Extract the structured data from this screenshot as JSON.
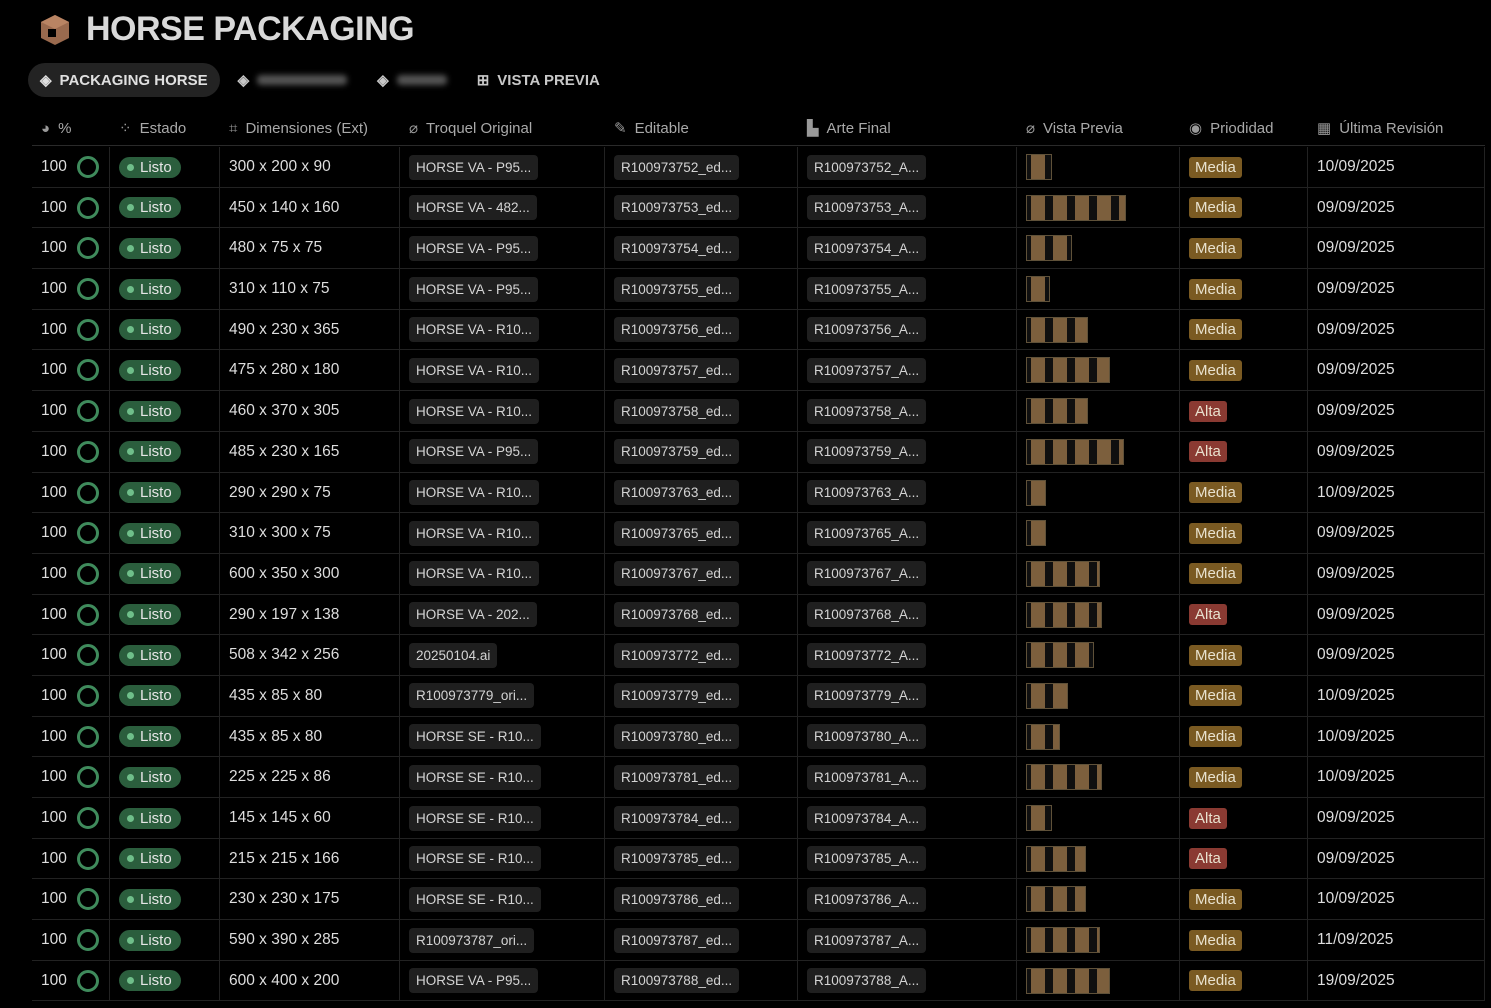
{
  "app": {
    "title": "HORSE PACKAGING",
    "brand_color": "#9a6a4e"
  },
  "tabs": [
    {
      "label": "PACKAGING HORSE",
      "icon": "cube-icon",
      "active": true
    },
    {
      "label": "",
      "icon": "cube-icon",
      "blurred": true
    },
    {
      "label": "",
      "icon": "cube-icon",
      "blurred": true
    },
    {
      "label": "VISTA PREVIA",
      "icon": "grid-icon"
    }
  ],
  "columns": [
    {
      "label": "%",
      "icon": "pie-icon"
    },
    {
      "label": "Estado",
      "icon": "loading-icon"
    },
    {
      "label": "Dimensiones (Ext)",
      "icon": "crop-icon"
    },
    {
      "label": "Troquel Original",
      "icon": "paperclip-icon"
    },
    {
      "label": "Editable",
      "icon": "pencil-icon"
    },
    {
      "label": "Arte Final",
      "icon": "printer-icon"
    },
    {
      "label": "Vista Previa",
      "icon": "paperclip-icon"
    },
    {
      "label": "Priodidad",
      "icon": "chevron-circle-icon"
    },
    {
      "label": "Última Revisión",
      "icon": "calendar-icon"
    }
  ],
  "colors": {
    "listo": "#2b5e3d",
    "media": "#7a5a22",
    "alta": "#8a3a32"
  },
  "rows": [
    {
      "pct": "100",
      "estado": "Listo",
      "dim": "300 x 200 x 90",
      "troquel": "HORSE VA - P95...",
      "editable": "R100973752_ed...",
      "arte": "R100973752_A...",
      "prio": "Media",
      "fecha": "10/09/2025"
    },
    {
      "pct": "100",
      "estado": "Listo",
      "dim": "450 x 140 x 160",
      "troquel": "HORSE VA - 482...",
      "editable": "R100973753_ed...",
      "arte": "R100973753_A...",
      "prio": "Media",
      "fecha": "09/09/2025"
    },
    {
      "pct": "100",
      "estado": "Listo",
      "dim": "480 x 75 x 75",
      "troquel": "HORSE VA - P95...",
      "editable": "R100973754_ed...",
      "arte": "R100973754_A...",
      "prio": "Media",
      "fecha": "09/09/2025"
    },
    {
      "pct": "100",
      "estado": "Listo",
      "dim": "310 x 110 x 75",
      "troquel": "HORSE VA - P95...",
      "editable": "R100973755_ed...",
      "arte": "R100973755_A...",
      "prio": "Media",
      "fecha": "09/09/2025"
    },
    {
      "pct": "100",
      "estado": "Listo",
      "dim": "490 x 230 x 365",
      "troquel": "HORSE VA - R10...",
      "editable": "R100973756_ed...",
      "arte": "R100973756_A...",
      "prio": "Media",
      "fecha": "09/09/2025"
    },
    {
      "pct": "100",
      "estado": "Listo",
      "dim": "475 x 280 x 180",
      "troquel": "HORSE VA - R10...",
      "editable": "R100973757_ed...",
      "arte": "R100973757_A...",
      "prio": "Media",
      "fecha": "09/09/2025"
    },
    {
      "pct": "100",
      "estado": "Listo",
      "dim": "460 x 370 x 305",
      "troquel": "HORSE VA - R10...",
      "editable": "R100973758_ed...",
      "arte": "R100973758_A...",
      "prio": "Alta",
      "fecha": "09/09/2025"
    },
    {
      "pct": "100",
      "estado": "Listo",
      "dim": "485 x 230 x 165",
      "troquel": "HORSE VA - P95...",
      "editable": "R100973759_ed...",
      "arte": "R100973759_A...",
      "prio": "Alta",
      "fecha": "09/09/2025"
    },
    {
      "pct": "100",
      "estado": "Listo",
      "dim": "290 x 290 x 75",
      "troquel": "HORSE VA - R10...",
      "editable": "R100973763_ed...",
      "arte": "R100973763_A...",
      "prio": "Media",
      "fecha": "10/09/2025"
    },
    {
      "pct": "100",
      "estado": "Listo",
      "dim": "310 x 300 x 75",
      "troquel": "HORSE VA - R10...",
      "editable": "R100973765_ed...",
      "arte": "R100973765_A...",
      "prio": "Media",
      "fecha": "09/09/2025"
    },
    {
      "pct": "100",
      "estado": "Listo",
      "dim": "600 x 350 x 300",
      "troquel": "HORSE VA - R10...",
      "editable": "R100973767_ed...",
      "arte": "R100973767_A...",
      "prio": "Media",
      "fecha": "09/09/2025"
    },
    {
      "pct": "100",
      "estado": "Listo",
      "dim": "290 x 197 x 138",
      "troquel": "HORSE VA - 202...",
      "editable": "R100973768_ed...",
      "arte": "R100973768_A...",
      "prio": "Alta",
      "fecha": "09/09/2025"
    },
    {
      "pct": "100",
      "estado": "Listo",
      "dim": "508 x 342 x 256",
      "troquel": "20250104.ai",
      "editable": "R100973772_ed...",
      "arte": "R100973772_A...",
      "prio": "Media",
      "fecha": "09/09/2025"
    },
    {
      "pct": "100",
      "estado": "Listo",
      "dim": "435 x 85 x 80",
      "troquel": "R100973779_ori...",
      "editable": "R100973779_ed...",
      "arte": "R100973779_A...",
      "prio": "Media",
      "fecha": "10/09/2025"
    },
    {
      "pct": "100",
      "estado": "Listo",
      "dim": "435 x 85 x 80",
      "troquel": "HORSE SE - R10...",
      "editable": "R100973780_ed...",
      "arte": "R100973780_A...",
      "prio": "Media",
      "fecha": "10/09/2025"
    },
    {
      "pct": "100",
      "estado": "Listo",
      "dim": "225 x 225 x 86",
      "troquel": "HORSE SE - R10...",
      "editable": "R100973781_ed...",
      "arte": "R100973781_A...",
      "prio": "Media",
      "fecha": "10/09/2025"
    },
    {
      "pct": "100",
      "estado": "Listo",
      "dim": "145 x 145 x 60",
      "troquel": "HORSE SE - R10...",
      "editable": "R100973784_ed...",
      "arte": "R100973784_A...",
      "prio": "Alta",
      "fecha": "09/09/2025"
    },
    {
      "pct": "100",
      "estado": "Listo",
      "dim": "215 x 215 x 166",
      "troquel": "HORSE SE - R10...",
      "editable": "R100973785_ed...",
      "arte": "R100973785_A...",
      "prio": "Alta",
      "fecha": "09/09/2025"
    },
    {
      "pct": "100",
      "estado": "Listo",
      "dim": "230 x 230 x 175",
      "troquel": "HORSE SE - R10...",
      "editable": "R100973786_ed...",
      "arte": "R100973786_A...",
      "prio": "Media",
      "fecha": "10/09/2025"
    },
    {
      "pct": "100",
      "estado": "Listo",
      "dim": "590 x 390 x 285",
      "troquel": "R100973787_ori...",
      "editable": "R100973787_ed...",
      "arte": "R100973787_A...",
      "prio": "Media",
      "fecha": "11/09/2025"
    },
    {
      "pct": "100",
      "estado": "Listo",
      "dim": "600 x 400 x 200",
      "troquel": "HORSE VA - P95...",
      "editable": "R100973788_ed...",
      "arte": "R100973788_A...",
      "prio": "Media",
      "fecha": "19/09/2025"
    }
  ]
}
